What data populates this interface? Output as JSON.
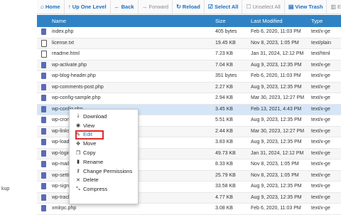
{
  "toolbar": {
    "buttons": [
      {
        "icon": "home-icon",
        "glyph": "⌂",
        "label": "Home",
        "disabled": false
      },
      {
        "icon": "up-icon",
        "glyph": "↑",
        "label": "Up One Level",
        "disabled": false
      },
      {
        "icon": "back-icon",
        "glyph": "←",
        "label": "Back",
        "disabled": false
      },
      {
        "icon": "forward-icon",
        "glyph": "→",
        "label": "Forward",
        "disabled": true
      },
      {
        "icon": "reload-icon",
        "glyph": "↻",
        "label": "Reload",
        "disabled": false
      },
      {
        "icon": "select-all-icon",
        "glyph": "☑",
        "label": "Select All",
        "disabled": false
      },
      {
        "icon": "unselect-all-icon",
        "glyph": "☐",
        "label": "Unselect All",
        "disabled": true
      },
      {
        "icon": "trash-icon",
        "glyph": "▤",
        "label": "View Trash",
        "disabled": false
      },
      {
        "icon": "empty-icon",
        "glyph": "▥",
        "label": "Empt",
        "disabled": true
      }
    ]
  },
  "table": {
    "headers": {
      "name": "Name",
      "size": "Size",
      "modified": "Last Modified",
      "type": "Type"
    },
    "rows": [
      {
        "name": "index.php",
        "size": "405 bytes",
        "modified": "Feb 6, 2020, 11:03 PM",
        "type": "text/x-ge",
        "icon": "php"
      },
      {
        "name": "license.txt",
        "size": "19.45 KB",
        "modified": "Nov 8, 2023, 1:05 PM",
        "type": "text/plain",
        "icon": "txt"
      },
      {
        "name": "readme.html",
        "size": "7.23 KB",
        "modified": "Jan 31, 2024, 12:12 PM",
        "type": "text/html",
        "icon": "html"
      },
      {
        "name": "wp-activate.php",
        "size": "7.04 KB",
        "modified": "Aug 9, 2023, 12:35 PM",
        "type": "text/x-ge",
        "icon": "php"
      },
      {
        "name": "wp-blog-header.php",
        "size": "351 bytes",
        "modified": "Feb 6, 2020, 11:03 PM",
        "type": "text/x-ge",
        "icon": "php"
      },
      {
        "name": "wp-comments-post.php",
        "size": "2.27 KB",
        "modified": "Aug 9, 2023, 12:35 PM",
        "type": "text/x-ge",
        "icon": "php"
      },
      {
        "name": "wp-config-sample.php",
        "size": "2.94 KB",
        "modified": "Mar 30, 2023, 12:27 PM",
        "type": "text/x-ge",
        "icon": "php"
      },
      {
        "name": "wp-config.php",
        "size": "3.45 KB",
        "modified": "Feb 13, 2021, 4:43 PM",
        "type": "text/x-ge",
        "icon": "php",
        "selected": true
      },
      {
        "name": "wp-cron.php",
        "size": "5.51 KB",
        "modified": "Aug 9, 2023, 12:35 PM",
        "type": "text/x-ge",
        "icon": "php"
      },
      {
        "name": "wp-links-opml.php",
        "size": "2.44 KB",
        "modified": "Mar 30, 2023, 12:27 PM",
        "type": "text/x-ge",
        "icon": "php"
      },
      {
        "name": "wp-load.php",
        "size": "3.83 KB",
        "modified": "Aug 9, 2023, 12:35 PM",
        "type": "text/x-ge",
        "icon": "php"
      },
      {
        "name": "wp-login.php",
        "size": "49.73 KB",
        "modified": "Jan 31, 2024, 12:12 PM",
        "type": "text/x-ge",
        "icon": "php"
      },
      {
        "name": "wp-mail.php",
        "size": "8.33 KB",
        "modified": "Nov 8, 2023, 1:05 PM",
        "type": "text/x-ge",
        "icon": "php"
      },
      {
        "name": "wp-settings.php",
        "size": "25.79 KB",
        "modified": "Nov 8, 2023, 1:05 PM",
        "type": "text/x-ge",
        "icon": "php"
      },
      {
        "name": "wp-signup.php",
        "size": "33.58 KB",
        "modified": "Aug 9, 2023, 12:35 PM",
        "type": "text/x-ge",
        "icon": "php"
      },
      {
        "name": "wp-trackback.php",
        "size": "4.77 KB",
        "modified": "Aug 9, 2023, 12:35 PM",
        "type": "text/x-ge",
        "icon": "php"
      },
      {
        "name": "xmlrpc.php",
        "size": "3.08 KB",
        "modified": "Feb 6, 2020, 11:03 PM",
        "type": "text/x-ge",
        "icon": "php"
      }
    ]
  },
  "context_menu": {
    "items": [
      {
        "icon": "download-icon",
        "glyph": "⤓",
        "label": "Download"
      },
      {
        "icon": "view-icon",
        "glyph": "◉",
        "label": "View"
      },
      {
        "icon": "edit-icon",
        "glyph": "✎",
        "label": "Edit",
        "highlighted": true
      },
      {
        "icon": "move-icon",
        "glyph": "✥",
        "label": "Move"
      },
      {
        "icon": "copy-icon",
        "glyph": "❐",
        "label": "Copy"
      },
      {
        "icon": "rename-icon",
        "glyph": "▮",
        "label": "Rename"
      },
      {
        "icon": "permissions-icon",
        "glyph": "⚷",
        "label": "Change Permissions"
      },
      {
        "icon": "delete-icon",
        "glyph": "✕",
        "label": "Delete"
      },
      {
        "icon": "compress-icon",
        "glyph": "⤡",
        "label": "Compress"
      }
    ]
  },
  "sidebar": {
    "partial_text": "kup"
  },
  "colors": {
    "accent": "#2f83c4",
    "link": "#1e6ebd",
    "highlight_border": "#e02b2b"
  }
}
